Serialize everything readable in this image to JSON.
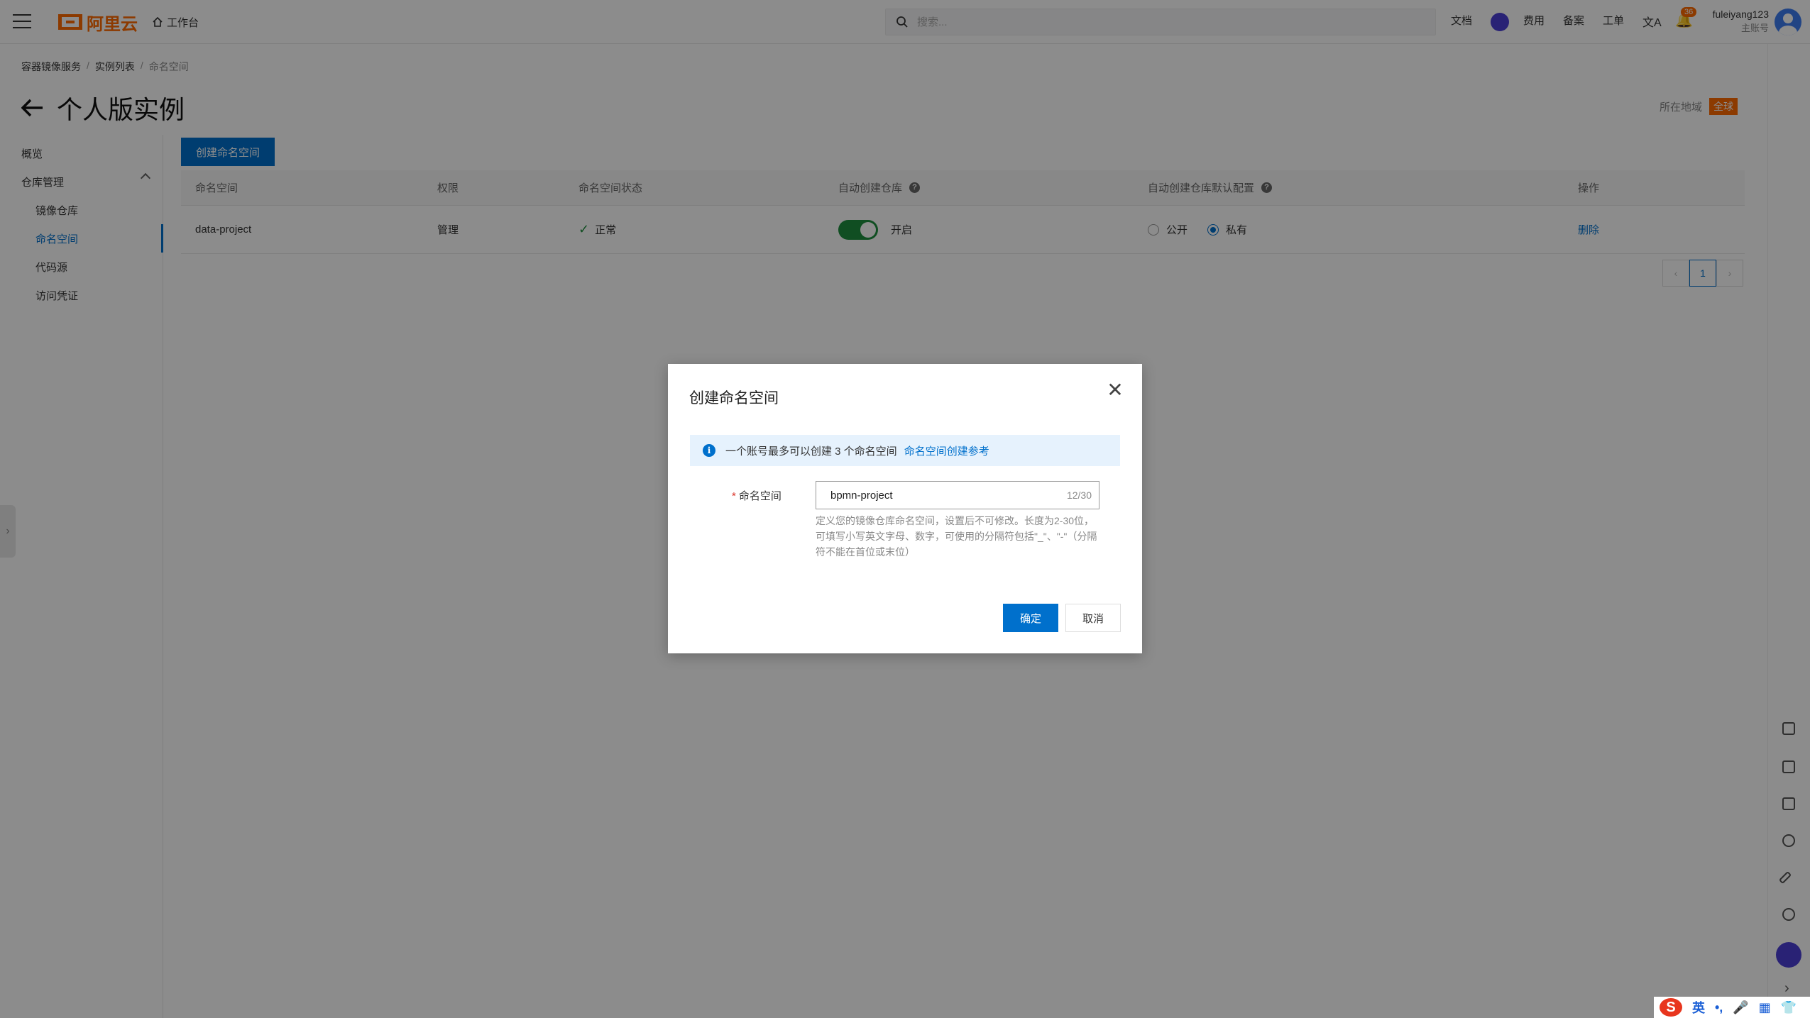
{
  "topbar": {
    "logo_text": "阿里云",
    "workbench": "工作台",
    "search_placeholder": "搜索...",
    "nav": [
      "文档",
      "费用",
      "备案",
      "工单"
    ],
    "notification_count": "36",
    "user_name": "fuleiyang123",
    "user_role": "主账号"
  },
  "breadcrumb": [
    "容器镜像服务",
    "实例列表",
    "命名空间"
  ],
  "page_title": "个人版实例",
  "region": {
    "label": "所在地域",
    "value": "全球"
  },
  "sidebar": {
    "overview": "概览",
    "group": "仓库管理",
    "items": [
      "镜像仓库",
      "命名空间",
      "代码源",
      "访问凭证"
    ]
  },
  "create_button": "创建命名空间",
  "table": {
    "headers": [
      "命名空间",
      "权限",
      "命名空间状态",
      "自动创建仓库",
      "自动创建仓库默认配置",
      "操作"
    ],
    "rows": [
      {
        "name": "data-project",
        "permission": "管理",
        "status": "正常",
        "auto_create": "开启",
        "auto_create_on": true,
        "public_label": "公开",
        "private_label": "私有",
        "default_visibility": "私有",
        "action": "删除"
      }
    ]
  },
  "pagination": {
    "current": "1"
  },
  "modal": {
    "title": "创建命名空间",
    "notice": "一个账号最多可以创建 3 个命名空间",
    "notice_link": "命名空间创建参考",
    "field_label": "命名空间",
    "field_value": "bpmn-project",
    "field_count": "12/30",
    "field_help": "定义您的镜像仓库命名空间，设置后不可修改。长度为2-30位，可填写小写英文字母、数字，可使用的分隔符包括\"_\"、\"-\"（分隔符不能在首位或末位）",
    "ok": "确定",
    "cancel": "取消"
  },
  "ime": {
    "lang": "英"
  },
  "colors": {
    "primary": "#0070cc",
    "brand": "#ff6a00",
    "success": "#1e8e3e"
  }
}
